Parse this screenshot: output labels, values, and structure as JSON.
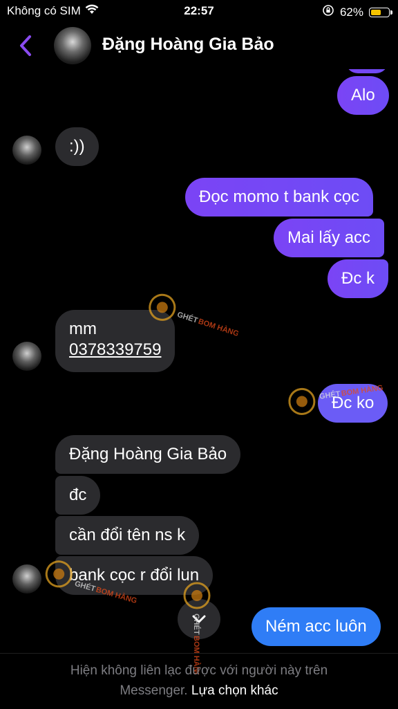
{
  "status_bar": {
    "carrier": "Không có SIM",
    "time": "22:57",
    "battery_percent": "62%",
    "battery_level": 0.62
  },
  "header": {
    "title": "Đặng Hoàng Gia Bảo"
  },
  "messages": {
    "m1": "Alo",
    "m2": ":))",
    "m3": "Đọc momo t bank cọc",
    "m4": "Mai lấy acc",
    "m5": "Đc k",
    "m6_line1": "mm",
    "m6_line2": "0378339759",
    "m7": "Đc ko",
    "m8": "Đặng Hoàng Gia Bảo",
    "m9": "đc",
    "m10": "cần đổi tên ns k",
    "m11": "bank cọc r đổi lun",
    "m12": "Ném acc luôn"
  },
  "footer": {
    "line1": "Hiện không liên lạc được với người này trên",
    "line2_prefix": "Messenger.",
    "line2_action": "Lựa chọn khác"
  },
  "watermark": {
    "text_a": "GHÉT",
    "text_b": "BOM HÀNG"
  },
  "colors": {
    "outgoing": "#7b44f5",
    "outgoing_blue": "#2f7df6",
    "incoming": "#2b2b2e",
    "accent": "#8a4bf0"
  }
}
